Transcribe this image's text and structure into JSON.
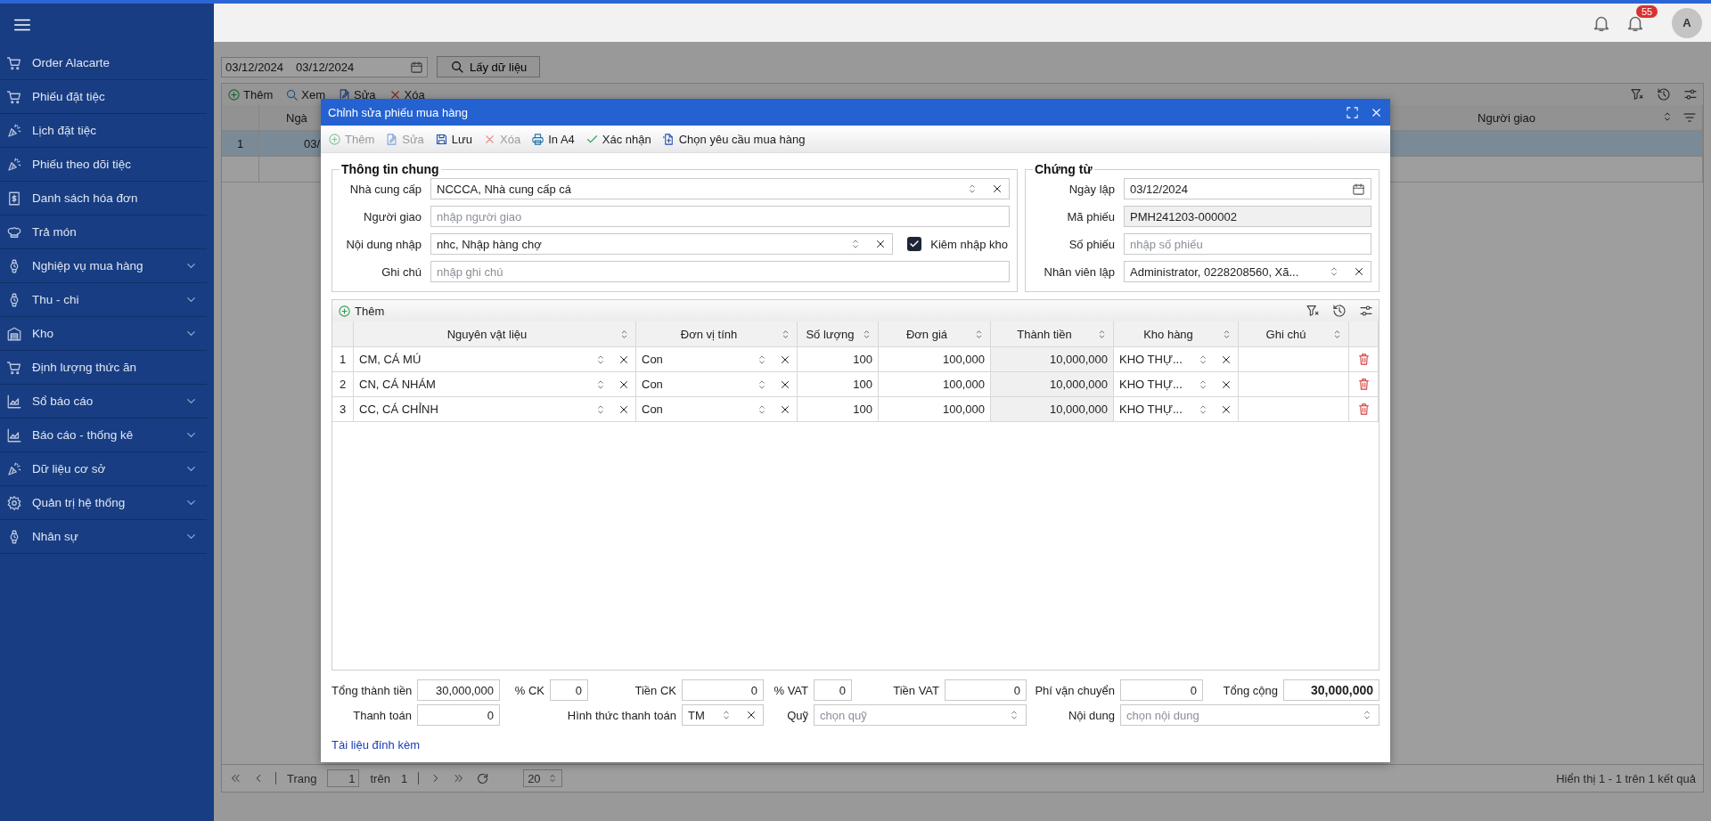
{
  "topbar": {
    "notification_count": "55",
    "avatar": "A"
  },
  "sidebar": {
    "items": [
      {
        "label": "Order Alacarte",
        "kind": "cart",
        "has_submenu": false
      },
      {
        "label": "Phiếu đặt tiệc",
        "kind": "cart",
        "has_submenu": false
      },
      {
        "label": "Lịch đặt tiệc",
        "kind": "party",
        "has_submenu": false
      },
      {
        "label": "Phiếu theo dõi tiệc",
        "kind": "party",
        "has_submenu": false
      },
      {
        "label": "Danh sách hóa đơn",
        "kind": "receipt",
        "has_submenu": false
      },
      {
        "label": "Trả món",
        "kind": "chef",
        "has_submenu": false
      },
      {
        "label": "Nghiệp vụ mua hàng",
        "kind": "watch",
        "has_submenu": true
      },
      {
        "label": "Thu - chi",
        "kind": "watch",
        "has_submenu": true
      },
      {
        "label": "Kho",
        "kind": "warehouse",
        "has_submenu": true
      },
      {
        "label": "Định lượng thức ăn",
        "kind": "cart",
        "has_submenu": false
      },
      {
        "label": "Sổ báo cáo",
        "kind": "chart",
        "has_submenu": true
      },
      {
        "label": "Báo cáo - thống kê",
        "kind": "chart",
        "has_submenu": true
      },
      {
        "label": "Dữ liệu cơ sở",
        "kind": "party",
        "has_submenu": true
      },
      {
        "label": "Quản trị hệ thống",
        "kind": "gear",
        "has_submenu": true
      },
      {
        "label": "Nhân sự",
        "kind": "watch",
        "has_submenu": true
      }
    ]
  },
  "list": {
    "date_from": "03/12/2024",
    "date_to": "03/12/2024",
    "load_button": "Lấy dữ liệu",
    "toolbar": [
      {
        "label": "Thêm",
        "kind": "add"
      },
      {
        "label": "Xem",
        "kind": "view"
      },
      {
        "label": "Sửa",
        "kind": "edit"
      },
      {
        "label": "Xóa",
        "kind": "delete"
      }
    ],
    "columns": [
      "Ngà",
      "Người giao"
    ],
    "rows": [
      {
        "number": "1",
        "column_1": "03/",
        "selected": true
      }
    ],
    "pager": {
      "page_label": "Trang",
      "page": "1",
      "of_label": "trên",
      "pages": "1",
      "page_size": "20",
      "summary": "Hiển thị 1 - 1 trên 1 kết quả"
    }
  },
  "dialog": {
    "title": "Chỉnh sửa phiếu mua hàng",
    "toolbar": [
      {
        "label": "Thêm",
        "kind": "add",
        "disabled": true
      },
      {
        "label": "Sửa",
        "kind": "edit",
        "disabled": true
      },
      {
        "label": "Lưu",
        "kind": "save",
        "disabled": false
      },
      {
        "label": "Xóa",
        "kind": "delete",
        "disabled": true
      },
      {
        "label": "In A4",
        "kind": "print",
        "disabled": false
      },
      {
        "label": "Xác nhận",
        "kind": "confirm",
        "disabled": false
      },
      {
        "label": "Chọn yêu cầu mua hàng",
        "kind": "request",
        "disabled": false
      }
    ],
    "general": {
      "title": "Thông tin chung",
      "fields": [
        {
          "label": "Nhà cung cấp",
          "kind": "select",
          "value": "NCCCA, Nhà cung cấp cá"
        },
        {
          "label": "Người giao",
          "kind": "text",
          "placeholder": "nhập người giao"
        },
        {
          "label": "Nội dung nhập",
          "kind": "select",
          "value": "nhc, Nhập hàng chợ"
        },
        {
          "label": "Ghi chú",
          "kind": "text",
          "placeholder": "nhập ghi chú"
        }
      ],
      "checkbox": {
        "label": "Kiêm nhập kho",
        "checked": true
      }
    },
    "voucher": {
      "title": "Chứng từ",
      "fields": [
        {
          "label": "Ngày lập",
          "kind": "date",
          "value": "03/12/2024"
        },
        {
          "label": "Mã phiếu",
          "kind": "readonly",
          "value": "PMH241203-000002"
        },
        {
          "label": "Số phiếu",
          "kind": "text",
          "placeholder": "nhập số phiếu"
        },
        {
          "label": "Nhân viên lập",
          "kind": "select",
          "value": "Administrator, 0228208560, Xã..."
        }
      ]
    },
    "lines": {
      "add_button": "Thêm",
      "columns": [
        "Nguyên vật liệu",
        "Đơn vị tính",
        "Số lượng",
        "Đơn giá",
        "Thành tiền",
        "Kho hàng",
        "Ghi chú"
      ],
      "rows": [
        {
          "number": "1",
          "material": "CM, CÁ MÚ",
          "unit": "Con",
          "quantity": "100",
          "price": "100,000",
          "amount": "10,000,000",
          "warehouse": "KHO THỰ..."
        },
        {
          "number": "2",
          "material": "CN, CÁ NHÁM",
          "unit": "Con",
          "quantity": "100",
          "price": "100,000",
          "amount": "10,000,000",
          "warehouse": "KHO THỰ..."
        },
        {
          "number": "3",
          "material": "CC, CÁ CHỈNH",
          "unit": "Con",
          "quantity": "100",
          "price": "100,000",
          "amount": "10,000,000",
          "warehouse": "KHO THỰ..."
        }
      ]
    },
    "totals": {
      "row_1": [
        {
          "label": "Tổng thành tiền",
          "value": "30,000,000",
          "emphasis": false
        },
        {
          "label": "% CK",
          "value": "0",
          "emphasis": false
        },
        {
          "label": "Tiền CK",
          "value": "0",
          "emphasis": false
        },
        {
          "label": "% VAT",
          "value": "0",
          "emphasis": false
        },
        {
          "label": "Tiền VAT",
          "value": "0",
          "emphasis": false
        },
        {
          "label": "Phí vận chuyển",
          "value": "0",
          "emphasis": false
        },
        {
          "label": "Tổng cộng",
          "value": "30,000,000",
          "emphasis": true
        }
      ],
      "row_2": [
        {
          "label": "Thanh toán",
          "kind": "input",
          "value": "0"
        },
        {
          "label": "Hình thức thanh toán",
          "kind": "select",
          "value": "TM"
        },
        {
          "label": "Quỹ",
          "kind": "select",
          "placeholder": "chọn quỹ"
        },
        {
          "label": "Nội dung",
          "kind": "select",
          "placeholder": "chọn nội dung"
        }
      ],
      "attachment_link": "Tài liệu đính kèm"
    }
  }
}
